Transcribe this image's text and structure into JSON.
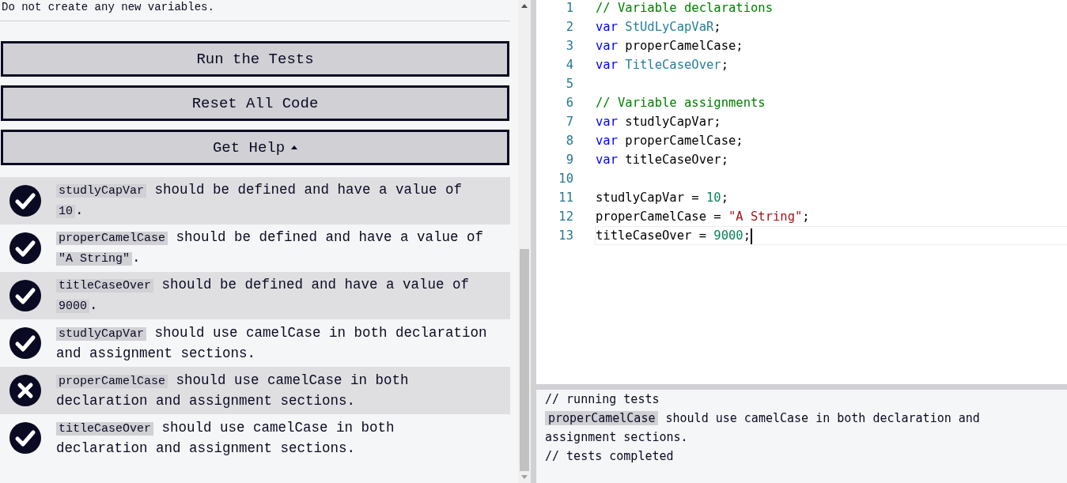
{
  "intro_text": "Do not create any new variables.",
  "buttons": [
    {
      "label": "Run the Tests",
      "kind": "plain"
    },
    {
      "label": "Reset All Code",
      "kind": "plain"
    },
    {
      "label": "Get Help",
      "kind": "dropdown"
    }
  ],
  "tests": [
    {
      "passed": true,
      "parts": [
        {
          "kind": "code",
          "text": "studlyCapVar"
        },
        {
          "kind": "text",
          "text": " should be defined and have a value of "
        },
        {
          "kind": "code",
          "text": "10"
        },
        {
          "kind": "text",
          "text": "."
        }
      ]
    },
    {
      "passed": true,
      "parts": [
        {
          "kind": "code",
          "text": "properCamelCase"
        },
        {
          "kind": "text",
          "text": " should be defined and have a value of "
        },
        {
          "kind": "code",
          "text": "\"A String\""
        },
        {
          "kind": "text",
          "text": "."
        }
      ]
    },
    {
      "passed": true,
      "parts": [
        {
          "kind": "code",
          "text": "titleCaseOver"
        },
        {
          "kind": "text",
          "text": " should be defined and have a value of "
        },
        {
          "kind": "code",
          "text": "9000"
        },
        {
          "kind": "text",
          "text": "."
        }
      ]
    },
    {
      "passed": true,
      "parts": [
        {
          "kind": "code",
          "text": "studlyCapVar"
        },
        {
          "kind": "text",
          "text": " should use camelCase in both declaration and assignment sections."
        }
      ]
    },
    {
      "passed": false,
      "parts": [
        {
          "kind": "code",
          "text": "properCamelCase"
        },
        {
          "kind": "text",
          "text": " should use camelCase in both declaration and assignment sections."
        }
      ]
    },
    {
      "passed": true,
      "parts": [
        {
          "kind": "code",
          "text": "titleCaseOver"
        },
        {
          "kind": "text",
          "text": " should use camelCase in both declaration and assignment sections."
        }
      ]
    }
  ],
  "editor": {
    "lines": [
      {
        "number": "1",
        "active": false,
        "tokens": [
          {
            "kind": "comment",
            "text": "// Variable declarations"
          }
        ]
      },
      {
        "number": "2",
        "active": false,
        "tokens": [
          {
            "kind": "keyword",
            "text": "var"
          },
          {
            "kind": "type",
            "text": "StUdLyCapVaR"
          },
          {
            "kind": "plain",
            "text": ";"
          }
        ]
      },
      {
        "number": "3",
        "active": false,
        "tokens": [
          {
            "kind": "keyword",
            "text": "var"
          },
          {
            "kind": "plain",
            "text": " properCamelCase;"
          }
        ]
      },
      {
        "number": "4",
        "active": false,
        "tokens": [
          {
            "kind": "keyword",
            "text": "var"
          },
          {
            "kind": "type",
            "text": "TitleCaseOver"
          },
          {
            "kind": "plain",
            "text": ";"
          }
        ]
      },
      {
        "number": "5",
        "active": false
      },
      {
        "number": "6",
        "active": false,
        "tokens": [
          {
            "kind": "comment",
            "text": "// Variable assignments"
          }
        ]
      },
      {
        "number": "7",
        "active": false,
        "tokens": [
          {
            "kind": "keyword",
            "text": "var"
          },
          {
            "kind": "plain",
            "text": " studlyCapVar;"
          }
        ]
      },
      {
        "number": "8",
        "active": false,
        "tokens": [
          {
            "kind": "keyword",
            "text": "var"
          },
          {
            "kind": "plain",
            "text": " properCamelCase;"
          }
        ]
      },
      {
        "number": "9",
        "active": false,
        "tokens": [
          {
            "kind": "keyword",
            "text": "var"
          },
          {
            "kind": "plain",
            "text": " titleCaseOver;"
          }
        ]
      },
      {
        "number": "10",
        "active": false
      },
      {
        "number": "11",
        "active": false,
        "tokens": [
          {
            "kind": "plain",
            "text": "studlyCapVar = "
          },
          {
            "kind": "number",
            "text": "10"
          },
          {
            "kind": "plain",
            "text": ";"
          }
        ]
      },
      {
        "number": "12",
        "active": false,
        "tokens": [
          {
            "kind": "plain",
            "text": "properCamelCase = "
          },
          {
            "kind": "string",
            "text": "\"A String\""
          },
          {
            "kind": "plain",
            "text": ";"
          }
        ]
      },
      {
        "number": "13",
        "active": true,
        "tokens": [
          {
            "kind": "plain",
            "text": "titleCaseOver = "
          },
          {
            "kind": "number",
            "text": "9000"
          },
          {
            "kind": "plain",
            "text": ";"
          }
        ]
      }
    ]
  },
  "console": {
    "lines": [
      {
        "parts": [
          {
            "kind": "text",
            "text": "// running tests"
          }
        ]
      },
      {
        "parts": [
          {
            "kind": "code",
            "text": "properCamelCase"
          },
          {
            "kind": "text",
            "text": " should use camelCase in both declaration and assignment sections."
          }
        ]
      },
      {
        "parts": [
          {
            "kind": "text",
            "text": "// tests completed"
          }
        ]
      }
    ]
  }
}
